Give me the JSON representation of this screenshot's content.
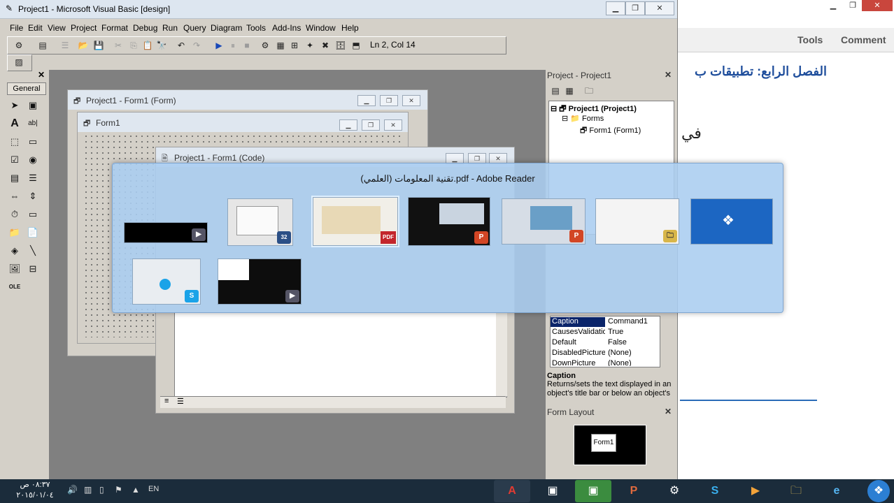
{
  "vb": {
    "window_title": "Project1 - Microsoft Visual Basic [design]",
    "menu": [
      "File",
      "Edit",
      "View",
      "Project",
      "Format",
      "Debug",
      "Run",
      "Query",
      "Diagram",
      "Tools",
      "Add-Ins",
      "Window",
      "Help"
    ],
    "status_position": "Ln 2, Col 14",
    "toolbox_tab": "General",
    "form_designer_title": "Project1 - Form1 (Form)",
    "form_caption": "Form1",
    "code_window_title": "Project1 - Form1 (Code)"
  },
  "project": {
    "title": "Project - Project1",
    "tree": [
      "Project1 (Project1)",
      "Forms",
      "Form1 (Form1)"
    ]
  },
  "properties": {
    "rows": [
      {
        "name": "Caption",
        "value": "Command1",
        "selected": true
      },
      {
        "name": "CausesValidation",
        "value": "True"
      },
      {
        "name": "Default",
        "value": "False"
      },
      {
        "name": "DisabledPicture",
        "value": "(None)"
      },
      {
        "name": "DownPicture",
        "value": "(None)"
      }
    ],
    "desc_title": "Caption",
    "desc_text": "Returns/sets the text displayed in an object's title bar or below an object's"
  },
  "layout": {
    "title": "Form Layout",
    "form_label": "Form1"
  },
  "switcher": {
    "title": "(تقنية المعلومات (العلمي.pdf - Adobe Reader"
  },
  "background_doc": {
    "ribbon": [
      "Tools",
      "Comment"
    ],
    "heading": "الفصل الرابع: تطبيقات ب",
    "snippet": "في"
  },
  "taskbar": {
    "time": "٠٨:٣٧ ص",
    "date": "٢٠١٥/٠١/٠٤",
    "lang": "EN"
  },
  "colors": {
    "selection": "#0a246a",
    "taskbar": "#1b2c3b",
    "active_task": "#3b8c3f"
  }
}
